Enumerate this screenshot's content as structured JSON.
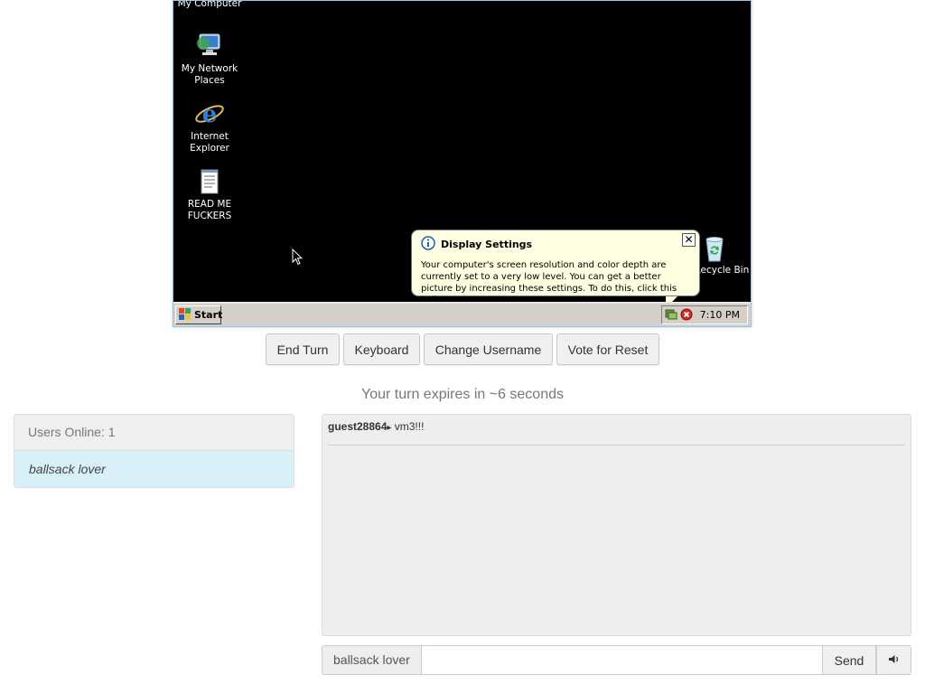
{
  "vm": {
    "desktop_icons": [
      {
        "label": "My Computer",
        "icon": "computer-icon"
      },
      {
        "label": "My Network Places",
        "icon": "network-places-icon"
      },
      {
        "label": "Internet Explorer",
        "icon": "internet-explorer-icon"
      },
      {
        "label": "READ ME FUCKERS",
        "icon": "notepad-document-icon"
      },
      {
        "label": "Recycle Bin",
        "icon": "recycle-bin-icon"
      }
    ],
    "balloon": {
      "title": "Display Settings",
      "body": "Your computer's screen resolution and color depth are currently set to a very low level. You can get a better picture by increasing these settings. To do this, click this balloon.",
      "close_glyph": "✕"
    },
    "taskbar": {
      "start_label": "Start",
      "clock": "7:10 PM"
    }
  },
  "controls": {
    "end_turn": "End Turn",
    "keyboard": "Keyboard",
    "change_username": "Change Username",
    "vote_reset": "Vote for Reset"
  },
  "turn_status": "Your turn expires in ~6 seconds",
  "users": {
    "header": "Users Online: 1",
    "list": [
      "ballsack lover"
    ]
  },
  "chat": {
    "messages": [
      {
        "user": "guest28864",
        "separator": "▸",
        "text": " vm3!!!"
      }
    ],
    "username_addon": "ballsack lover",
    "input_value": "",
    "send_label": "Send",
    "volume_glyph": "🔈"
  },
  "colors": {
    "accent_user_row": "#d9f0fb",
    "balloon_bg": "#ffffe1",
    "vm_border": "#9ec5e0"
  }
}
